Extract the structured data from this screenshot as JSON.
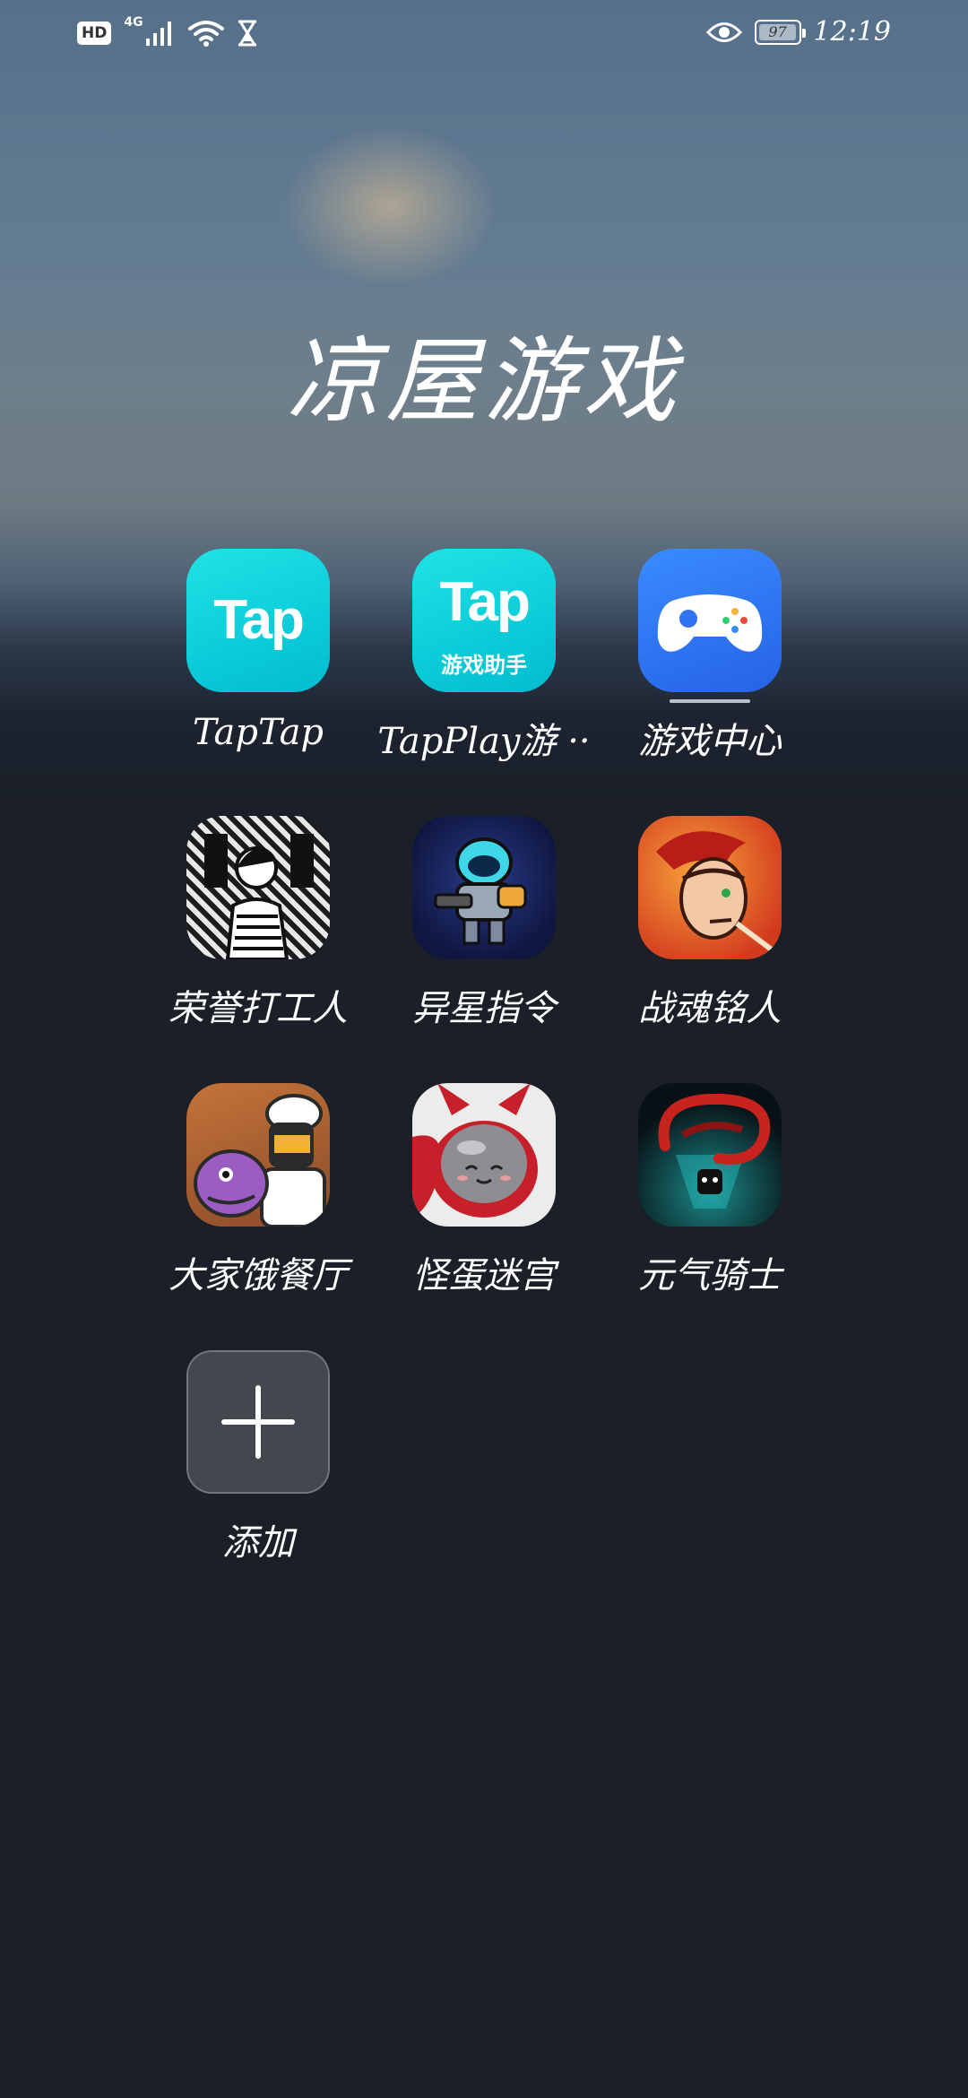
{
  "status_bar": {
    "hd": "HD",
    "network": "4G",
    "battery_level": "97",
    "time": "12:19"
  },
  "folder": {
    "title": "凉屋游戏",
    "apps": [
      {
        "label": "TapTap",
        "icon": "taptap-icon"
      },
      {
        "label": "TapPlay游 ··",
        "icon": "tapplay-icon",
        "icon_text": "Tap",
        "icon_subtext": "游戏助手"
      },
      {
        "label": "游戏中心",
        "icon": "game-center-icon"
      },
      {
        "label": "荣誉打工人",
        "icon": "rongyu-dagongren-icon"
      },
      {
        "label": "异星指令",
        "icon": "yixing-zhiling-icon"
      },
      {
        "label": "战魂铭人",
        "icon": "zhanhun-mingren-icon"
      },
      {
        "label": "大家饿餐厅",
        "icon": "dajia-e-canting-icon"
      },
      {
        "label": "怪蛋迷宫",
        "icon": "guaidan-migong-icon"
      },
      {
        "label": "元气骑士",
        "icon": "yuanqi-qishi-icon"
      },
      {
        "label": "添加",
        "icon": "add-icon"
      }
    ],
    "taptap_icon_text": "Tap"
  },
  "colors": {
    "taptap": "#00c4d4",
    "game_center": "#2f74f2",
    "background": "#1a1f28"
  }
}
